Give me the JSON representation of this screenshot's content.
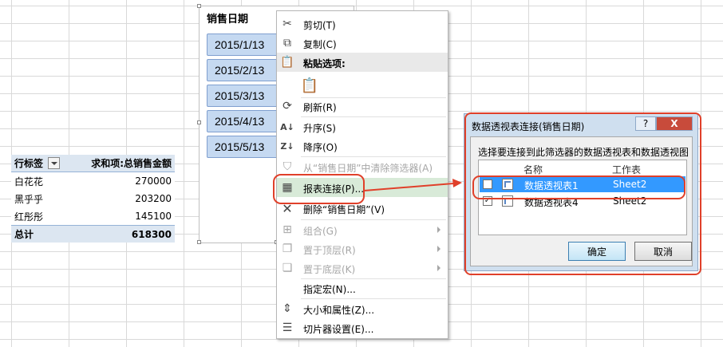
{
  "pivot": {
    "header": {
      "row_label": "行标签",
      "value_label": "求和项:总销售金额"
    },
    "rows": [
      {
        "name": "白花花",
        "value": "270000"
      },
      {
        "name": "黑乎乎",
        "value": "203200"
      },
      {
        "name": "红彤彤",
        "value": "145100"
      }
    ],
    "total": {
      "name": "总计",
      "value": "618300"
    }
  },
  "slicer": {
    "title": "销售日期",
    "items": [
      "2015/1/13",
      "2015/2/13",
      "2015/3/13",
      "2015/4/13",
      "2015/5/13"
    ]
  },
  "context_menu": {
    "cut": "剪切(T)",
    "copy": "复制(C)",
    "paste_options": "粘贴选项:",
    "refresh": "刷新(R)",
    "sort_asc": "升序(S)",
    "sort_desc": "降序(O)",
    "clear_filter": "从“销售日期”中清除筛选器(A)",
    "report_connections": "报表连接(P)...",
    "delete": "删除“销售日期”(V)",
    "group": "组合(G)",
    "bring_front": "置于顶层(R)",
    "send_back": "置于底层(K)",
    "assign_macro": "指定宏(N)...",
    "size_props": "大小和属性(Z)...",
    "slicer_settings": "切片器设置(E)..."
  },
  "dialog": {
    "title": "数据透视表连接(销售日期)",
    "help": "?",
    "close": "X",
    "prompt": "选择要连接到此筛选器的数据透视表和数据透视图",
    "col_name": "名称",
    "col_sheet": "工作表",
    "rows": [
      {
        "name": "数据透视表1",
        "sheet": "Sheet2",
        "checked": false,
        "selected": true
      },
      {
        "name": "数据透视表4",
        "sheet": "Sheet2",
        "checked": true,
        "selected": false
      }
    ],
    "ok": "确定",
    "cancel": "取消",
    "check_mark": "✓"
  },
  "colors": {
    "annotation_red": "#e0402a",
    "selection_blue": "#3399ff",
    "slicer_item": "#c5d9f1"
  }
}
